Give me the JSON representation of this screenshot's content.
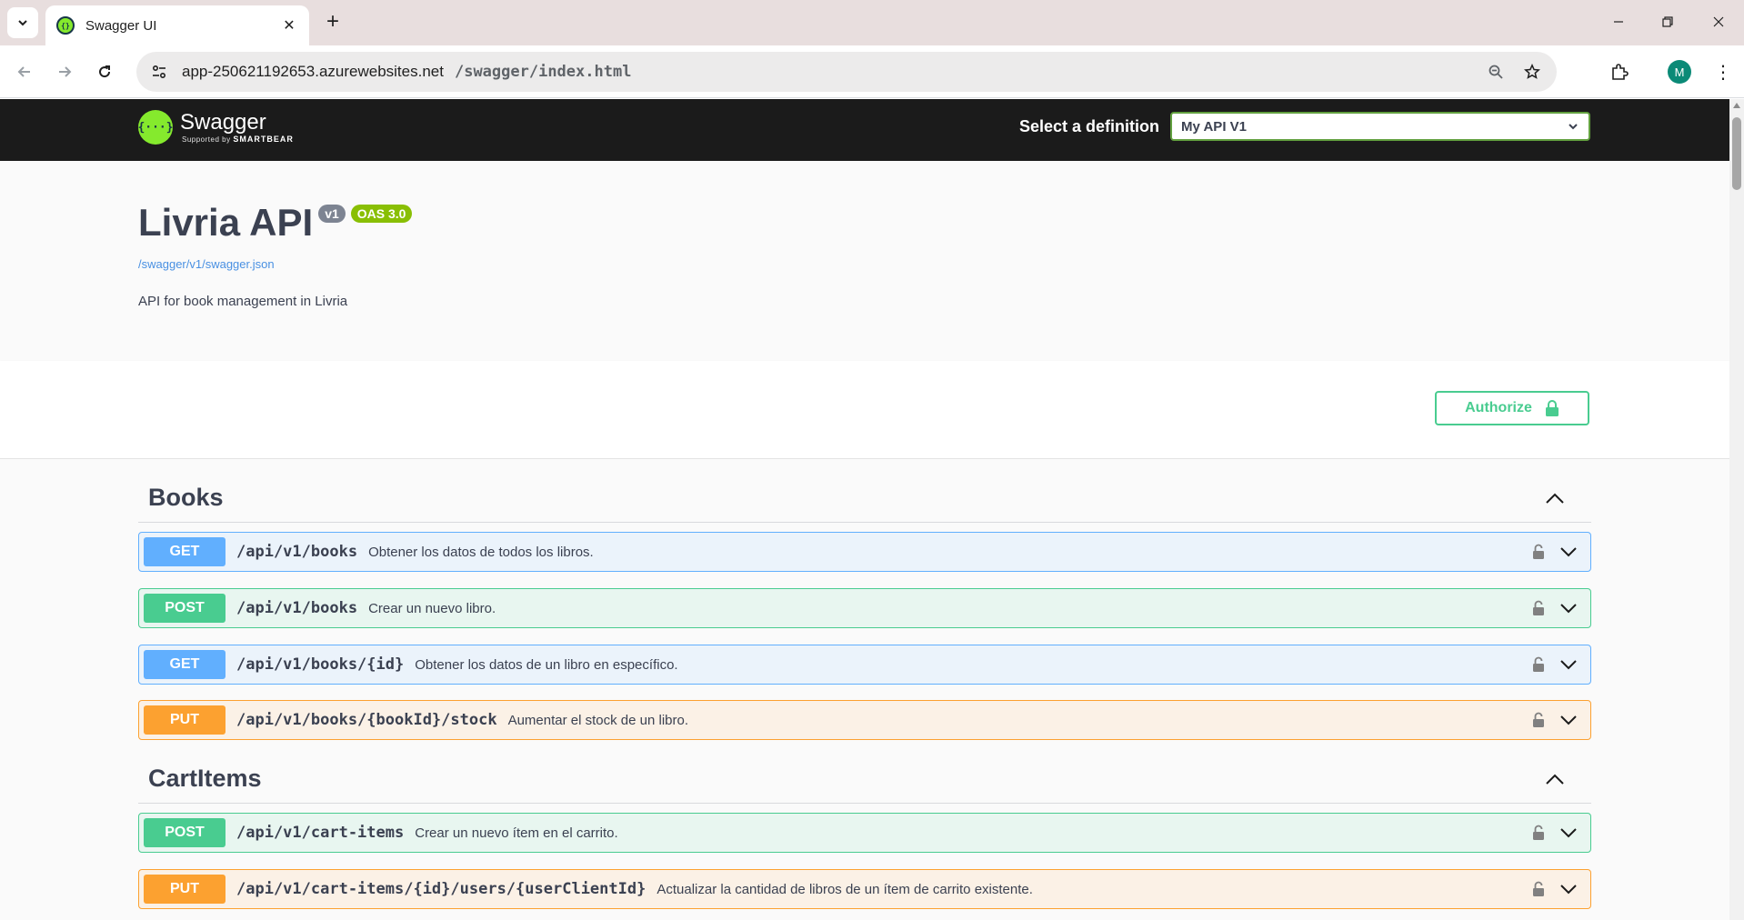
{
  "browser": {
    "tab_title": "Swagger UI",
    "url_host": "app-250621192653.azurewebsites.net",
    "url_path": "/swagger/index.html",
    "profile_initial": "M"
  },
  "topbar": {
    "logo_name": "Swagger",
    "logo_sub_prefix": "Supported by",
    "logo_sub_brand": "SMARTBEAR",
    "definition_label": "Select a definition",
    "definition_value": "My API V1"
  },
  "info": {
    "title": "Livria API",
    "version": "v1",
    "oas": "OAS 3.0",
    "spec_url": "/swagger/v1/swagger.json",
    "description": "API for book management in Livria"
  },
  "authorize_label": "Authorize",
  "colors": {
    "get": "#61affe",
    "post": "#49cc90",
    "put": "#fca130",
    "swagger_green": "#85ea2d"
  },
  "tags": [
    {
      "name": "Books",
      "operations": [
        {
          "method": "GET",
          "path": "/api/v1/books",
          "summary": "Obtener los datos de todos los libros."
        },
        {
          "method": "POST",
          "path": "/api/v1/books",
          "summary": "Crear un nuevo libro."
        },
        {
          "method": "GET",
          "path": "/api/v1/books/{id}",
          "summary": "Obtener los datos de un libro en específico."
        },
        {
          "method": "PUT",
          "path": "/api/v1/books/{bookId}/stock",
          "summary": "Aumentar el stock de un libro."
        }
      ]
    },
    {
      "name": "CartItems",
      "operations": [
        {
          "method": "POST",
          "path": "/api/v1/cart-items",
          "summary": "Crear un nuevo ítem en el carrito."
        },
        {
          "method": "PUT",
          "path": "/api/v1/cart-items/{id}/users/{userClientId}",
          "summary": "Actualizar la cantidad de libros de un ítem de carrito existente."
        }
      ]
    }
  ]
}
